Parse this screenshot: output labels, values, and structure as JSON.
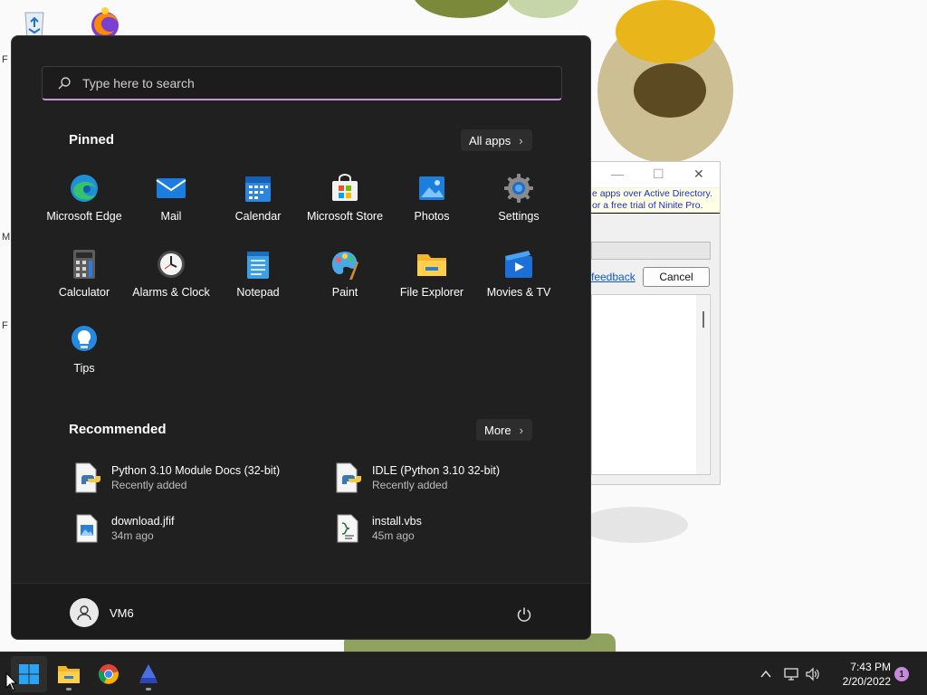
{
  "start_menu": {
    "search": {
      "placeholder": "Type here to search"
    },
    "pinned": {
      "title": "Pinned",
      "all_apps_label": "All apps",
      "apps": [
        {
          "label": "Microsoft Edge",
          "icon": "edge-icon"
        },
        {
          "label": "Mail",
          "icon": "mail-icon"
        },
        {
          "label": "Calendar",
          "icon": "calendar-icon"
        },
        {
          "label": "Microsoft Store",
          "icon": "store-icon"
        },
        {
          "label": "Photos",
          "icon": "photos-icon"
        },
        {
          "label": "Settings",
          "icon": "gear-icon"
        },
        {
          "label": "Calculator",
          "icon": "calculator-icon"
        },
        {
          "label": "Alarms & Clock",
          "icon": "clock-icon"
        },
        {
          "label": "Notepad",
          "icon": "notepad-icon"
        },
        {
          "label": "Paint",
          "icon": "paint-icon"
        },
        {
          "label": "File Explorer",
          "icon": "folder-icon"
        },
        {
          "label": "Movies & TV",
          "icon": "movies-icon"
        },
        {
          "label": "Tips",
          "icon": "lightbulb-icon"
        }
      ]
    },
    "recommended": {
      "title": "Recommended",
      "more_label": "More",
      "items": [
        {
          "name": "Python 3.10 Module Docs (32-bit)",
          "sub": "Recently added",
          "icon": "python-doc-icon"
        },
        {
          "name": "IDLE (Python 3.10 32-bit)",
          "sub": "Recently added",
          "icon": "python-idle-icon"
        },
        {
          "name": "download.jfif",
          "sub": "34m ago",
          "icon": "image-file-icon"
        },
        {
          "name": "install.vbs",
          "sub": "45m ago",
          "icon": "script-file-icon"
        }
      ]
    },
    "user": {
      "name": "VM6"
    }
  },
  "dialog": {
    "ad_line1": "e apps over Active Directory.",
    "ad_line2": "or a free trial of Ninite Pro.",
    "feedback_label": "feedback",
    "cancel_label": "Cancel"
  },
  "taskbar": {
    "time": "7:43 PM",
    "date": "2/20/2022",
    "notification_count": "1"
  },
  "colors": {
    "start_bg": "#202020",
    "accent": "#c896d8",
    "taskbar_bg": "#202020"
  }
}
